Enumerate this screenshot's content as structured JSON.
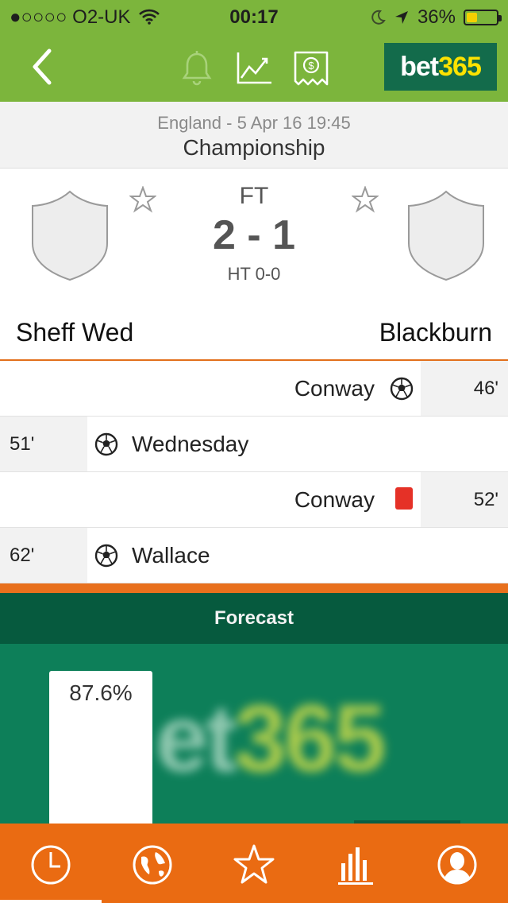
{
  "status_bar": {
    "carrier": "●○○○○ O2-UK",
    "time": "00:17",
    "battery": "36%",
    "battery_level": 0.36
  },
  "header": {
    "icons": [
      "back-chevron-icon",
      "bell-icon",
      "trend-chart-icon",
      "bet-slip-icon"
    ],
    "brand_part1": "bet",
    "brand_part2": "365"
  },
  "match": {
    "league_line": "England - 5 Apr 16  19:45",
    "competition": "Championship",
    "status": "FT",
    "score": "2 - 1",
    "half_time": "HT 0-0",
    "home_team": "Sheff Wed",
    "away_team": "Blackburn"
  },
  "events": [
    {
      "side": "away",
      "type": "goal",
      "player": "Conway",
      "minute": "46'"
    },
    {
      "side": "home",
      "type": "goal",
      "player": "Wednesday",
      "minute": "51'"
    },
    {
      "side": "away",
      "type": "red-card",
      "player": "Conway",
      "minute": "52'"
    },
    {
      "side": "home",
      "type": "goal",
      "player": "Wallace",
      "minute": "62'"
    }
  ],
  "forecast": {
    "title": "Forecast",
    "home_pct": "87.6%",
    "watermark_a": "et",
    "watermark_b": "365"
  },
  "tabbar": {
    "tabs": [
      "clock-icon",
      "globe-icon",
      "star-icon",
      "stats-icon",
      "profile-icon"
    ],
    "active_tab": 0
  },
  "colors": {
    "header_green": "#7cb53c",
    "accent_orange": "#ea6b12",
    "forecast_dark": "#065a3e",
    "forecast_green": "#0d7f59",
    "brand_yellow": "#fde201"
  }
}
